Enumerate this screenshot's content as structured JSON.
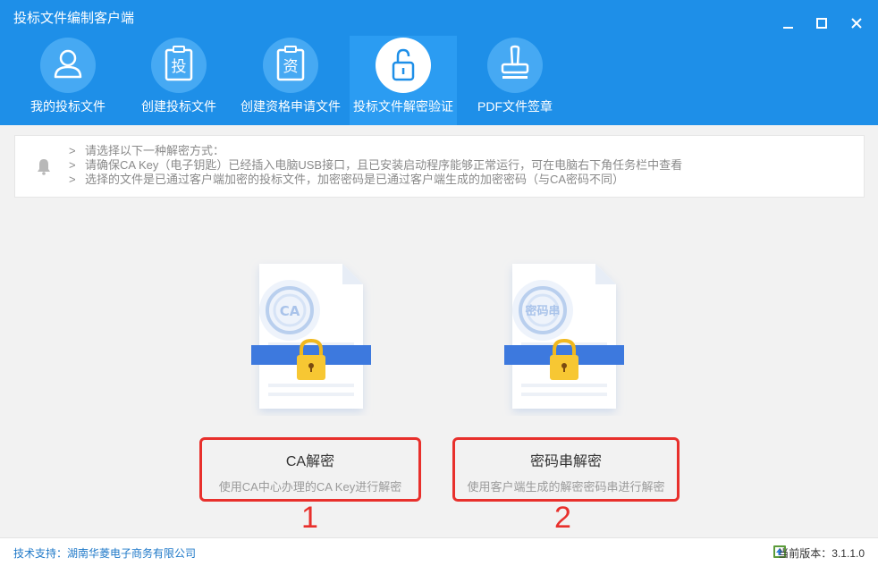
{
  "window": {
    "title": "投标文件编制客户端"
  },
  "nav": [
    {
      "label": "我的投标文件",
      "icon": "user-icon"
    },
    {
      "label": "创建投标文件",
      "icon": "clipboard-tou-icon",
      "glyph": "投"
    },
    {
      "label": "创建资格申请文件",
      "icon": "clipboard-zi-icon",
      "glyph": "资"
    },
    {
      "label": "投标文件解密验证",
      "icon": "unlock-icon",
      "active": true
    },
    {
      "label": "PDF文件签章",
      "icon": "stamp-icon"
    }
  ],
  "notice": {
    "lines": [
      "请选择以下一种解密方式：",
      "请确保CA Key（电子钥匙）已经插入电脑USB接口，且已安装启动程序能够正常运行，可在电脑右下角任务栏中查看",
      "选择的文件是已通过客户端加密的投标文件，加密密码是已通过客户端生成的加密密码（与CA密码不同）"
    ],
    "bullet": ">"
  },
  "options": [
    {
      "seal_text": "CA",
      "title": "CA解密",
      "desc": "使用CA中心办理的CA Key进行解密",
      "number": "1"
    },
    {
      "seal_text": "密码串",
      "title": "密码串解密",
      "desc": "使用客户端生成的解密密码串进行解密",
      "number": "2"
    }
  ],
  "status": {
    "support": "技术支持：湖南华菱电子商务有限公司",
    "version": "当前版本：3.1.1.0"
  },
  "colors": {
    "primary": "#1e8fe8",
    "annotation_red": "#e8302c"
  }
}
